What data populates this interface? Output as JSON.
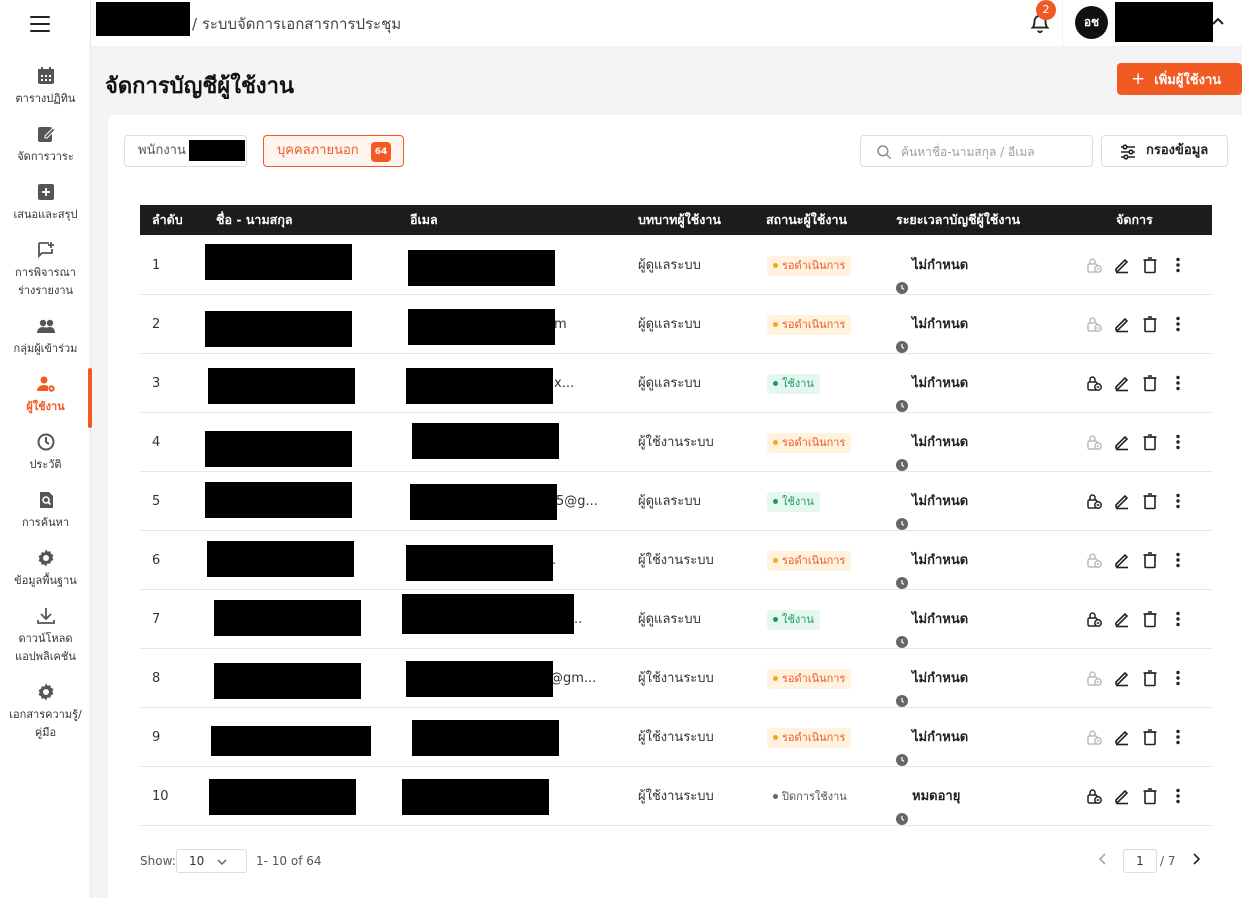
{
  "topbar": {
    "breadcrumb": "/ ระบบจัดการเอกสารการประชุม",
    "notification_count": "2",
    "avatar_initials": "อช"
  },
  "sidebar": {
    "items": [
      {
        "label": "ตารางปฏิทิน",
        "icon": "calendar-icon"
      },
      {
        "label": "จัดการวาระ",
        "icon": "edit-note-icon"
      },
      {
        "label": "เสนอและสรุป",
        "icon": "add-box-icon"
      },
      {
        "label": "การพิจารณา\nร่างรายงาน",
        "icon": "chat-plus-icon"
      },
      {
        "label": "กลุ่มผู้เข้าร่วม",
        "icon": "group-icon"
      },
      {
        "label": "ผู้ใช้งาน",
        "icon": "user-settings-icon"
      },
      {
        "label": "ประวัติ",
        "icon": "history-icon"
      },
      {
        "label": "การค้นหา",
        "icon": "search-doc-icon"
      },
      {
        "label": "ข้อมูลพื้นฐาน",
        "icon": "gear-icon"
      },
      {
        "label": "ดาวน์โหลด\nแอปพลิเคชัน",
        "icon": "download-icon"
      },
      {
        "label": "เอกสารความรู้/\nคู่มือ",
        "icon": "gear-icon"
      }
    ],
    "active_index": 5
  },
  "page": {
    "title": "จัดการบัญชีผู้ใช้งาน",
    "add_button": "เพิ่มผู้ใช้งาน",
    "add_button_icon": "+"
  },
  "tabs": {
    "staff": "พนักงาน",
    "external": "บุคคลภายนอก",
    "external_count": "64"
  },
  "search": {
    "placeholder": "ค้นหาชื่อ-นามสกุล / อีเมล"
  },
  "filter_button": "กรองข้อมูล",
  "table": {
    "headers": [
      "ลำดับ",
      "ชื่อ - นามสกุล",
      "อีเมล",
      "บทบาทผู้ใช้งาน",
      "สถานะผู้ใช้งาน",
      "ระยะเวลาบัญชีผู้ใช้งาน",
      "จัดการ"
    ],
    "rows": [
      {
        "no": "1",
        "email_tail": "",
        "role": "ผู้ดูแลระบบ",
        "status": "รอดำเนินการ",
        "status_type": "pending",
        "duration": "ไม่กำหนด",
        "lock_enabled": false
      },
      {
        "no": "2",
        "email_tail": "m",
        "role": "ผู้ดูแลระบบ",
        "status": "รอดำเนินการ",
        "status_type": "pending",
        "duration": "ไม่กำหนด",
        "lock_enabled": false
      },
      {
        "no": "3",
        "email_tail": "x...",
        "role": "ผู้ดูแลระบบ",
        "status": "ใช้งาน",
        "status_type": "active",
        "duration": "ไม่กำหนด",
        "lock_enabled": true
      },
      {
        "no": "4",
        "email_tail": "",
        "role": "ผู้ใช้งานระบบ",
        "status": "รอดำเนินการ",
        "status_type": "pending",
        "duration": "ไม่กำหนด",
        "lock_enabled": false
      },
      {
        "no": "5",
        "email_tail": "5@g...",
        "role": "ผู้ดูแลระบบ",
        "status": "ใช้งาน",
        "status_type": "active",
        "duration": "ไม่กำหนด",
        "lock_enabled": true
      },
      {
        "no": "6",
        "email_tail": ".",
        "role": "ผู้ใช้งานระบบ",
        "status": "รอดำเนินการ",
        "status_type": "pending",
        "duration": "ไม่กำหนด",
        "lock_enabled": false
      },
      {
        "no": "7",
        "email_tail": "..",
        "role": "ผู้ดูแลระบบ",
        "status": "ใช้งาน",
        "status_type": "active",
        "duration": "ไม่กำหนด",
        "lock_enabled": true
      },
      {
        "no": "8",
        "email_tail": "@gm...",
        "role": "ผู้ใช้งานระบบ",
        "status": "รอดำเนินการ",
        "status_type": "pending",
        "duration": "ไม่กำหนด",
        "lock_enabled": false
      },
      {
        "no": "9",
        "email_tail": "",
        "role": "ผู้ใช้งานระบบ",
        "status": "รอดำเนินการ",
        "status_type": "pending",
        "duration": "ไม่กำหนด",
        "lock_enabled": false
      },
      {
        "no": "10",
        "email_tail": "",
        "role": "ผู้ใช้งานระบบ",
        "status": "ปิดการใช้งาน",
        "status_type": "inactive",
        "duration": "หมดอายุ",
        "lock_enabled": true
      }
    ]
  },
  "footer": {
    "show_label": "Show:",
    "page_size": "10",
    "range": "1- 10 of 64",
    "current_page": "1",
    "total_pages": "/ 7"
  },
  "colors": {
    "accent": "#f15a22",
    "header_bg": "#1c1c1c",
    "active_green": "#1a9b63",
    "pending_bg": "#fff3e0"
  }
}
